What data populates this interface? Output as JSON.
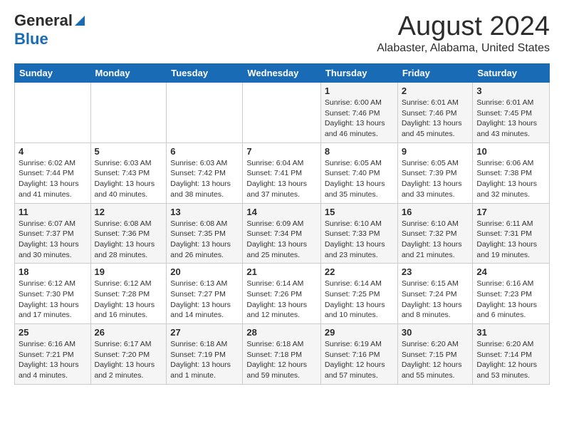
{
  "header": {
    "logo_line1": "General",
    "logo_line2": "Blue",
    "title": "August 2024",
    "subtitle": "Alabaster, Alabama, United States"
  },
  "calendar": {
    "weekdays": [
      "Sunday",
      "Monday",
      "Tuesday",
      "Wednesday",
      "Thursday",
      "Friday",
      "Saturday"
    ],
    "weeks": [
      [
        {
          "day": "",
          "info": ""
        },
        {
          "day": "",
          "info": ""
        },
        {
          "day": "",
          "info": ""
        },
        {
          "day": "",
          "info": ""
        },
        {
          "day": "1",
          "info": "Sunrise: 6:00 AM\nSunset: 7:46 PM\nDaylight: 13 hours\nand 46 minutes."
        },
        {
          "day": "2",
          "info": "Sunrise: 6:01 AM\nSunset: 7:46 PM\nDaylight: 13 hours\nand 45 minutes."
        },
        {
          "day": "3",
          "info": "Sunrise: 6:01 AM\nSunset: 7:45 PM\nDaylight: 13 hours\nand 43 minutes."
        }
      ],
      [
        {
          "day": "4",
          "info": "Sunrise: 6:02 AM\nSunset: 7:44 PM\nDaylight: 13 hours\nand 41 minutes."
        },
        {
          "day": "5",
          "info": "Sunrise: 6:03 AM\nSunset: 7:43 PM\nDaylight: 13 hours\nand 40 minutes."
        },
        {
          "day": "6",
          "info": "Sunrise: 6:03 AM\nSunset: 7:42 PM\nDaylight: 13 hours\nand 38 minutes."
        },
        {
          "day": "7",
          "info": "Sunrise: 6:04 AM\nSunset: 7:41 PM\nDaylight: 13 hours\nand 37 minutes."
        },
        {
          "day": "8",
          "info": "Sunrise: 6:05 AM\nSunset: 7:40 PM\nDaylight: 13 hours\nand 35 minutes."
        },
        {
          "day": "9",
          "info": "Sunrise: 6:05 AM\nSunset: 7:39 PM\nDaylight: 13 hours\nand 33 minutes."
        },
        {
          "day": "10",
          "info": "Sunrise: 6:06 AM\nSunset: 7:38 PM\nDaylight: 13 hours\nand 32 minutes."
        }
      ],
      [
        {
          "day": "11",
          "info": "Sunrise: 6:07 AM\nSunset: 7:37 PM\nDaylight: 13 hours\nand 30 minutes."
        },
        {
          "day": "12",
          "info": "Sunrise: 6:08 AM\nSunset: 7:36 PM\nDaylight: 13 hours\nand 28 minutes."
        },
        {
          "day": "13",
          "info": "Sunrise: 6:08 AM\nSunset: 7:35 PM\nDaylight: 13 hours\nand 26 minutes."
        },
        {
          "day": "14",
          "info": "Sunrise: 6:09 AM\nSunset: 7:34 PM\nDaylight: 13 hours\nand 25 minutes."
        },
        {
          "day": "15",
          "info": "Sunrise: 6:10 AM\nSunset: 7:33 PM\nDaylight: 13 hours\nand 23 minutes."
        },
        {
          "day": "16",
          "info": "Sunrise: 6:10 AM\nSunset: 7:32 PM\nDaylight: 13 hours\nand 21 minutes."
        },
        {
          "day": "17",
          "info": "Sunrise: 6:11 AM\nSunset: 7:31 PM\nDaylight: 13 hours\nand 19 minutes."
        }
      ],
      [
        {
          "day": "18",
          "info": "Sunrise: 6:12 AM\nSunset: 7:30 PM\nDaylight: 13 hours\nand 17 minutes."
        },
        {
          "day": "19",
          "info": "Sunrise: 6:12 AM\nSunset: 7:28 PM\nDaylight: 13 hours\nand 16 minutes."
        },
        {
          "day": "20",
          "info": "Sunrise: 6:13 AM\nSunset: 7:27 PM\nDaylight: 13 hours\nand 14 minutes."
        },
        {
          "day": "21",
          "info": "Sunrise: 6:14 AM\nSunset: 7:26 PM\nDaylight: 13 hours\nand 12 minutes."
        },
        {
          "day": "22",
          "info": "Sunrise: 6:14 AM\nSunset: 7:25 PM\nDaylight: 13 hours\nand 10 minutes."
        },
        {
          "day": "23",
          "info": "Sunrise: 6:15 AM\nSunset: 7:24 PM\nDaylight: 13 hours\nand 8 minutes."
        },
        {
          "day": "24",
          "info": "Sunrise: 6:16 AM\nSunset: 7:23 PM\nDaylight: 13 hours\nand 6 minutes."
        }
      ],
      [
        {
          "day": "25",
          "info": "Sunrise: 6:16 AM\nSunset: 7:21 PM\nDaylight: 13 hours\nand 4 minutes."
        },
        {
          "day": "26",
          "info": "Sunrise: 6:17 AM\nSunset: 7:20 PM\nDaylight: 13 hours\nand 2 minutes."
        },
        {
          "day": "27",
          "info": "Sunrise: 6:18 AM\nSunset: 7:19 PM\nDaylight: 13 hours\nand 1 minute."
        },
        {
          "day": "28",
          "info": "Sunrise: 6:18 AM\nSunset: 7:18 PM\nDaylight: 12 hours\nand 59 minutes."
        },
        {
          "day": "29",
          "info": "Sunrise: 6:19 AM\nSunset: 7:16 PM\nDaylight: 12 hours\nand 57 minutes."
        },
        {
          "day": "30",
          "info": "Sunrise: 6:20 AM\nSunset: 7:15 PM\nDaylight: 12 hours\nand 55 minutes."
        },
        {
          "day": "31",
          "info": "Sunrise: 6:20 AM\nSunset: 7:14 PM\nDaylight: 12 hours\nand 53 minutes."
        }
      ]
    ]
  }
}
